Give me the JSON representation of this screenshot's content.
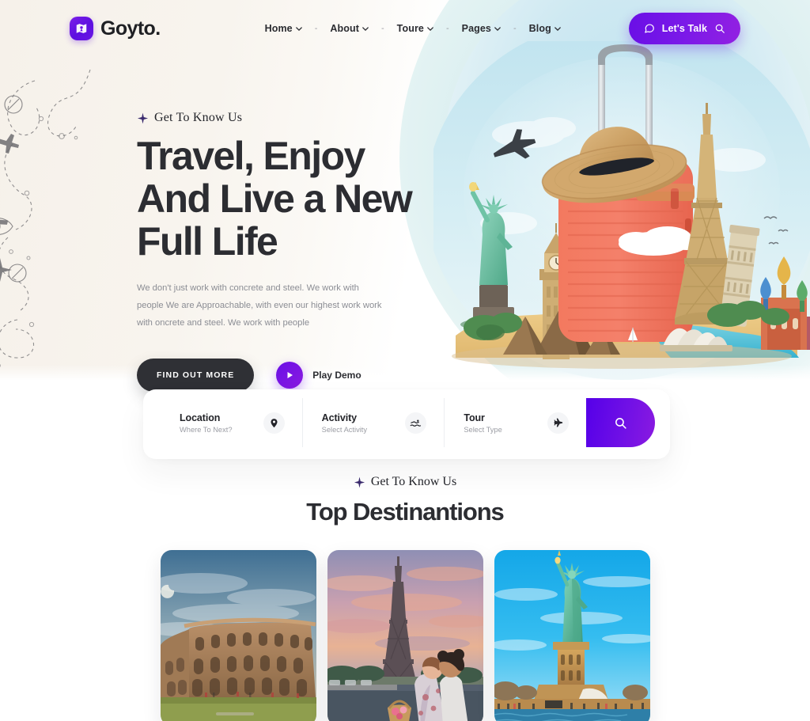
{
  "header": {
    "brand_name": "Goyto.",
    "brand_icon": "map-badge-icon",
    "nav": [
      {
        "label": "Home",
        "has_caret": true
      },
      {
        "label": "About",
        "has_caret": true
      },
      {
        "label": "Toure",
        "has_caret": true
      },
      {
        "label": "Pages",
        "has_caret": true
      },
      {
        "label": "Blog",
        "has_caret": true
      }
    ],
    "nav_separator": "-",
    "cta": {
      "label": "Let's Talk",
      "left_icon": "chat-bubble-icon",
      "right_icon": "search-icon",
      "color": "#6a0fe6"
    }
  },
  "hero": {
    "eyebrow": "Get To Know Us",
    "eyebrow_icon": "sparkle-star-icon",
    "headline_lines": [
      "Travel, Enjoy",
      "And Live a New",
      "Full Life"
    ],
    "paragraph": "We don't just work with concrete and steel. We work with people We are Approachable, with even our highest work work with oncrete and steel. We work with people",
    "primary_button": "FIND OUT MORE",
    "play_label": "Play Demo",
    "play_icon": "play-triangle-icon",
    "collage_alt": "travel-collage-suitcase-landmarks"
  },
  "search": {
    "fields": [
      {
        "title": "Location",
        "sub": "Where To Next?",
        "icon": "map-pin-icon"
      },
      {
        "title": "Activity",
        "sub": "Select Activity",
        "icon": "swimmer-icon"
      },
      {
        "title": "Tour",
        "sub": "Select Type",
        "icon": "airplane-icon"
      }
    ],
    "button_icon": "search-icon",
    "button_color": "#6a0fe6"
  },
  "destinations": {
    "eyebrow": "Get To Know Us",
    "eyebrow_icon": "sparkle-star-icon",
    "title": "Top Destinantions",
    "cards": [
      {
        "image": "colosseum-rome"
      },
      {
        "image": "eiffel-tower-paris-couple"
      },
      {
        "image": "statue-of-liberty-new-york"
      }
    ]
  },
  "theme": {
    "accent": "#6a0fe6",
    "accent_alt": "#8a1ae0",
    "dark": "#2f3035",
    "text_muted": "#8b8d94",
    "hero_bg": "#f7f2ec",
    "sky": "#cfe9f2"
  }
}
